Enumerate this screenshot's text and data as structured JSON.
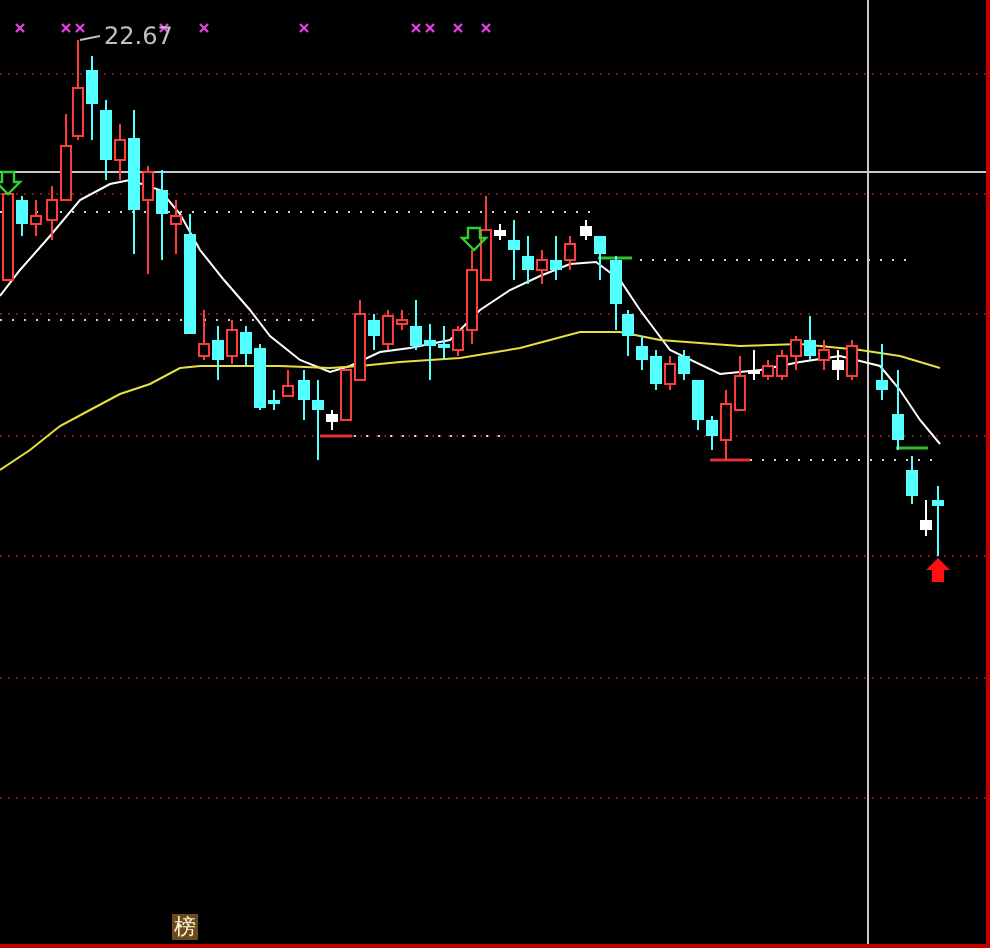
{
  "chart": {
    "high_label": "22.67"
  },
  "badge": {
    "text": "榜"
  }
}
